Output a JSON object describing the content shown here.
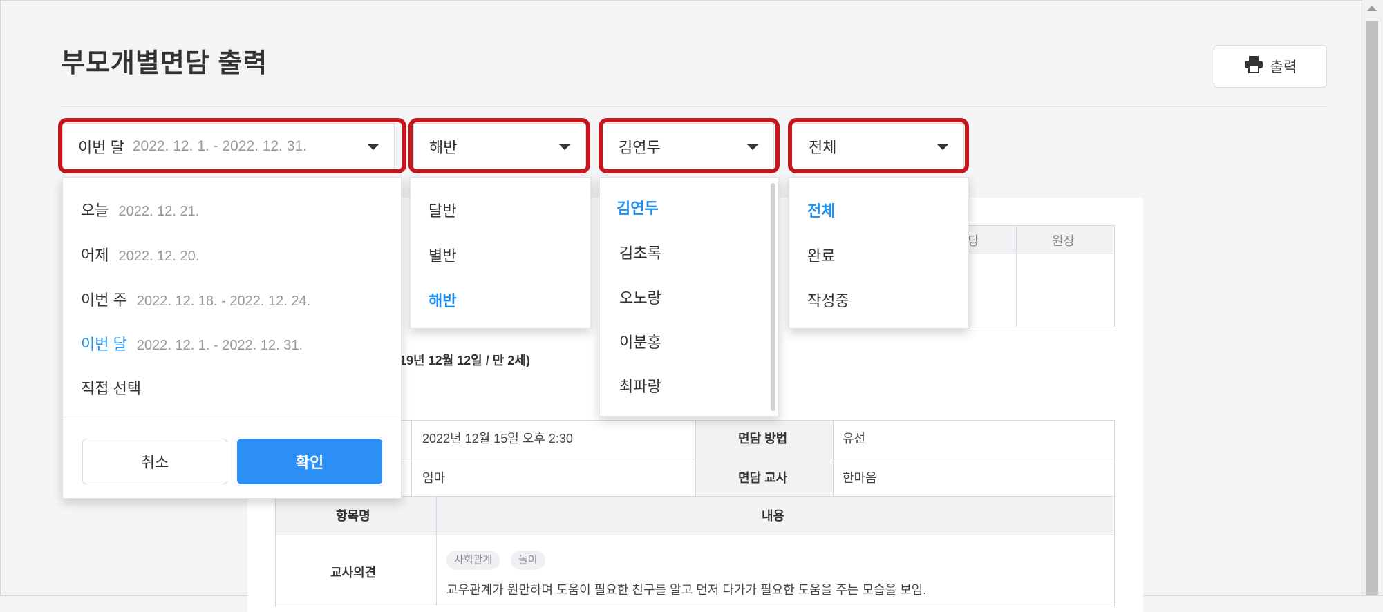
{
  "page": {
    "title": "부모개별면담 출력",
    "print_label": "출력"
  },
  "filters": {
    "period": {
      "label": "이번 달",
      "range": "2022. 12. 1. - 2022. 12. 31."
    },
    "class": {
      "label": "해반"
    },
    "child": {
      "label": "김연두"
    },
    "status": {
      "label": "전체"
    }
  },
  "period_menu": {
    "items": [
      {
        "label": "오늘",
        "range": "2022. 12. 21."
      },
      {
        "label": "어제",
        "range": "2022. 12. 20."
      },
      {
        "label": "이번 주",
        "range": "2022. 12. 18. - 2022. 12. 24."
      },
      {
        "label": "이번 달",
        "range": "2022. 12. 1. - 2022. 12. 31.",
        "selected": true
      },
      {
        "label": "직접 선택",
        "range": ""
      }
    ],
    "cancel_label": "취소",
    "confirm_label": "확인"
  },
  "class_menu": {
    "items": [
      "달반",
      "별반",
      "해반"
    ],
    "selected": "해반"
  },
  "child_menu": {
    "items": [
      "김연두",
      "김초록",
      "오노랑",
      "이분홍",
      "최파랑"
    ],
    "selected": "김연두"
  },
  "status_menu": {
    "items": [
      "전체",
      "완료",
      "작성중"
    ],
    "selected": "전체"
  },
  "document": {
    "approval_partial_header": "당",
    "approval_director": "원장",
    "child_info_partial": "19년 12월 12일 / 만 2세)",
    "meeting_datetime": "2022년 12월 15일 오후 2:30",
    "method_label": "면담 방법",
    "method_value": "유선",
    "participant_value": "엄마",
    "teacher_label": "면담 교사",
    "teacher_value": "한마음",
    "col_item": "항목명",
    "col_content": "내용",
    "row_label": "교사의견",
    "tags": [
      "사회관계",
      "놀이"
    ],
    "opinion": "교우관계가 원만하며 도움이 필요한 친구를 알고 먼저 다가가 필요한 도움을 주는 모습을 보임."
  }
}
